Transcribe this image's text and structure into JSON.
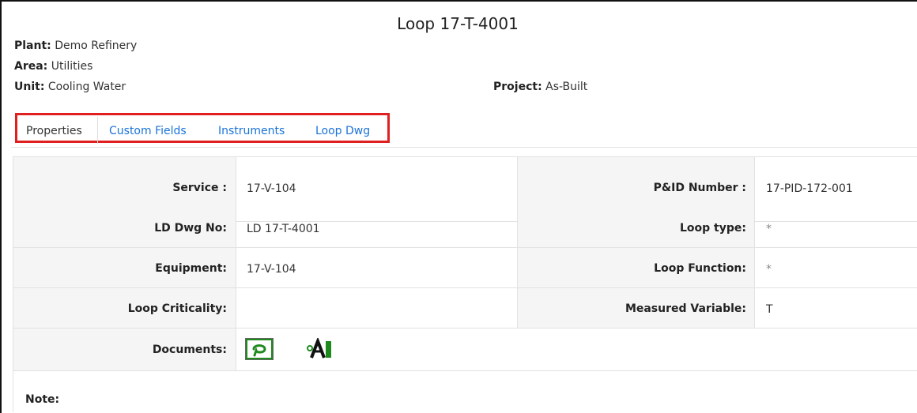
{
  "page": {
    "title": "Loop 17-T-4001"
  },
  "meta": {
    "plant_label": "Plant:",
    "plant_value": "Demo Refinery",
    "area_label": "Area:",
    "area_value": "Utilities",
    "unit_label": "Unit:",
    "unit_value": "Cooling Water",
    "project_label": "Project:",
    "project_value": "As-Built"
  },
  "tabs": [
    {
      "label": "Properties",
      "active": true
    },
    {
      "label": "Custom Fields",
      "active": false
    },
    {
      "label": "Instruments",
      "active": false
    },
    {
      "label": "Loop Dwg",
      "active": false
    }
  ],
  "properties": {
    "rows": [
      {
        "left_label": "Service :",
        "left_value": "17-V-104",
        "right_label": "P&ID Number :",
        "right_value": "17-PID-172-001"
      },
      {
        "left_label": "LD Dwg No:",
        "left_value": "LD 17-T-4001",
        "right_label": "Loop type:",
        "right_value": "*"
      },
      {
        "left_label": "Equipment:",
        "left_value": "17-V-104",
        "right_label": "Loop Function:",
        "right_value": "*"
      },
      {
        "left_label": "Loop Criticality:",
        "left_value": "",
        "right_label": "Measured Variable:",
        "right_value": "T"
      }
    ],
    "documents_label": "Documents:",
    "documents": [
      {
        "icon": "loop-drawing-icon",
        "color": "#1e8a1e"
      },
      {
        "icon": "autocad-drawing-icon",
        "color": "#1e8a1e"
      }
    ],
    "note_label": "Note:"
  }
}
